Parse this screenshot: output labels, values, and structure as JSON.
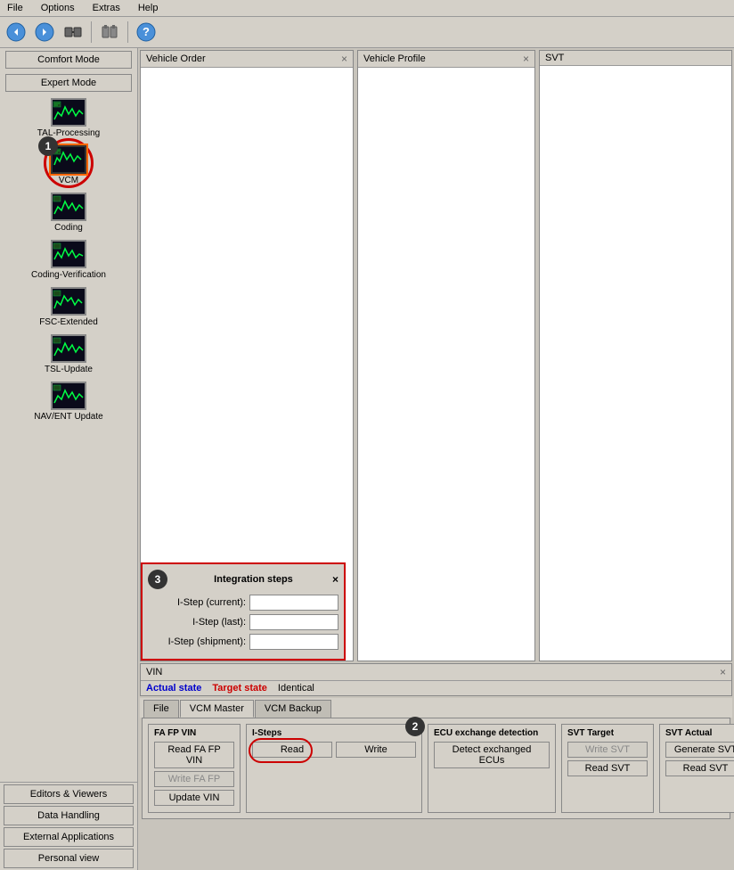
{
  "menubar": {
    "items": [
      "File",
      "Options",
      "Extras",
      "Help"
    ]
  },
  "toolbar": {
    "buttons": [
      "back",
      "forward",
      "connect",
      "help"
    ]
  },
  "sidebar": {
    "modes": [
      "Comfort Mode",
      "Expert Mode"
    ],
    "items": [
      {
        "id": "tal-processing",
        "label": "TAL-Processing"
      },
      {
        "id": "vcm",
        "label": "VCM",
        "selected": true
      },
      {
        "id": "coding",
        "label": "Coding"
      },
      {
        "id": "coding-verification",
        "label": "Coding-Verification"
      },
      {
        "id": "fsc-extended",
        "label": "FSC-Extended"
      },
      {
        "id": "tsl-update",
        "label": "TSL-Update"
      },
      {
        "id": "nav-ent-update",
        "label": "NAV/ENT Update"
      }
    ],
    "bottom_buttons": [
      {
        "id": "editors-viewers",
        "label": "Editors & Viewers"
      },
      {
        "id": "data-handling",
        "label": "Data Handling"
      },
      {
        "id": "external-applications",
        "label": "External Applications",
        "active": false
      },
      {
        "id": "personal-view",
        "label": "Personal view"
      }
    ]
  },
  "panels": {
    "vehicle_order": {
      "title": "Vehicle Order"
    },
    "vehicle_profile": {
      "title": "Vehicle Profile"
    },
    "svt": {
      "title": "SVT"
    }
  },
  "integration_steps": {
    "title": "Integration steps",
    "fields": [
      {
        "id": "i-step-current",
        "label": "I-Step (current):",
        "value": ""
      },
      {
        "id": "i-step-last",
        "label": "I-Step (last):",
        "value": ""
      },
      {
        "id": "i-step-shipment",
        "label": "I-Step (shipment):",
        "value": ""
      }
    ]
  },
  "vin_panel": {
    "title": "VIN"
  },
  "status_bar": {
    "actual_state_label": "Actual state",
    "target_state_label": "Target state",
    "identical_label": "Identical"
  },
  "tabs": {
    "items": [
      "File",
      "VCM Master",
      "VCM Backup"
    ],
    "active": "VCM Master"
  },
  "tab_content": {
    "groups": {
      "fa_fp_vin": {
        "title": "FA FP VIN",
        "buttons": [
          {
            "id": "read-fa-fp-vin",
            "label": "Read FA FP VIN",
            "disabled": false
          },
          {
            "id": "write-fa-fp",
            "label": "Write FA FP",
            "disabled": true
          },
          {
            "id": "update-vin",
            "label": "Update VIN",
            "disabled": false
          }
        ]
      },
      "i_steps": {
        "title": "I-Steps",
        "buttons": [
          {
            "id": "read",
            "label": "Read",
            "disabled": false
          },
          {
            "id": "write",
            "label": "Write",
            "disabled": false
          }
        ]
      },
      "ecu_exchange": {
        "title": "ECU exchange detection",
        "buttons": [
          {
            "id": "detect-exchanged-ecus",
            "label": "Detect exchanged ECUs",
            "disabled": false
          }
        ]
      },
      "svt_target": {
        "title": "SVT Target",
        "buttons": [
          {
            "id": "write-svt",
            "label": "Write SVT",
            "disabled": true
          },
          {
            "id": "read-svt-target",
            "label": "Read SVT",
            "disabled": false
          }
        ]
      },
      "svt_actual": {
        "title": "SVT Actual",
        "buttons": [
          {
            "id": "generate-svt",
            "label": "Generate SVT",
            "disabled": false
          },
          {
            "id": "read-svt-actual",
            "label": "Read SVT",
            "disabled": false
          }
        ]
      }
    }
  },
  "badges": {
    "badge1": "1",
    "badge2": "2",
    "badge3": "3"
  }
}
